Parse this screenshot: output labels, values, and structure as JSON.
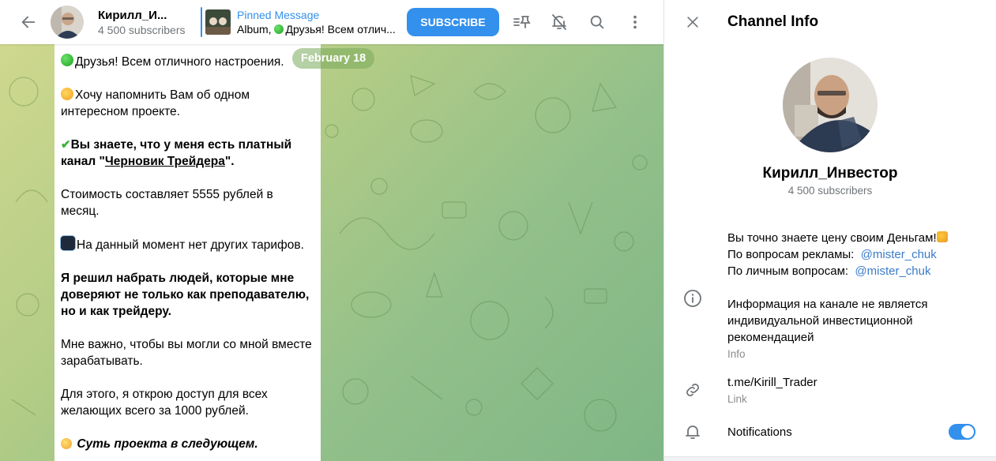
{
  "colors": {
    "accent": "#3390ec",
    "link": "#3a7bc8",
    "muted": "#707579"
  },
  "topbar": {
    "back_icon": "arrow-left-icon",
    "channel_title": "Кирилл_И...",
    "subscribers": "4 500 subscribers",
    "pinned": {
      "label": "Pinned Message",
      "preview_prefix": "Album, ",
      "preview_text": "Друзья! Всем отлич..."
    },
    "subscribe_label": "SUBSCRIBE",
    "icons": [
      "pinned-list-icon",
      "mute-bell-icon",
      "search-icon",
      "more-vertical-icon"
    ]
  },
  "chat": {
    "date_label": "February 18",
    "message": {
      "p1": "Друзья! Всем отличного настроения.",
      "p2": "Хочу напомнить Вам об одном интересном проекте.",
      "p3_pre": "Вы знаете, что у меня есть платный канал \"",
      "p3_link": "Черновик Трейдера",
      "p3_post": "\".",
      "p4": "Стоимость составляет 5555 рублей в месяц.",
      "p5": "На данный момент нет других тарифов.",
      "p6": "Я решил набрать людей, которые мне доверяют не только как преподавателю, но и как трейдеру.",
      "p7": "Мне важно, чтобы вы могли со мной вместе зарабатывать.",
      "p8": "Для этого, я открою доступ для всех желающих всего за 1000 рублей.",
      "p9": "Суть проекта в следующем."
    }
  },
  "panel": {
    "title": "Channel Info",
    "close_icon": "close-icon",
    "name": "Кирилл_Инвестор",
    "subscribers": "4 500 subscribers",
    "about": {
      "line1": "Вы точно знаете цену своим Деньгам!",
      "ads_label": "По вопросам рекламы:  ",
      "ads_link": "@mister_chuk",
      "personal_label": "По личным вопросам:  ",
      "personal_link": "@mister_chuk",
      "disclaimer": "Информация на канале не является индивидуальной инвестиционной рекомендацией",
      "sub_label": "Info"
    },
    "link": {
      "value": "t.me/Kirill_Trader",
      "sub_label": "Link"
    },
    "notifications": {
      "label": "Notifications",
      "enabled": true
    }
  }
}
